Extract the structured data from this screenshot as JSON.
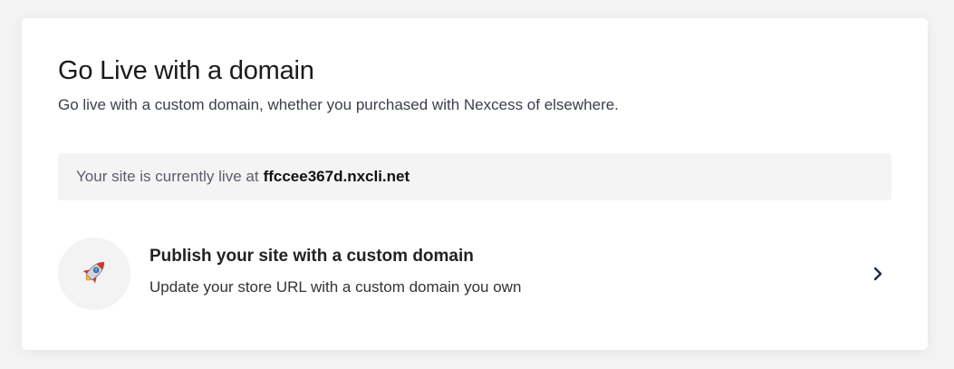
{
  "card": {
    "title": "Go Live with a domain",
    "subtitle": "Go live with a custom domain, whether you purchased with Nexcess of elsewhere."
  },
  "live_status": {
    "prefix": "Your site is currently live at",
    "domain": "ffccee367d.nxcli.net"
  },
  "publish_option": {
    "icon": "rocket-icon",
    "title": "Publish your site with a custom domain",
    "description": "Update your store URL with a custom domain you own",
    "action_icon": "chevron-right-icon"
  },
  "colors": {
    "page_background": "#f3f3f3",
    "card_background": "#ffffff",
    "live_box_background": "#f4f4f4",
    "chevron": "#1f2a44"
  }
}
